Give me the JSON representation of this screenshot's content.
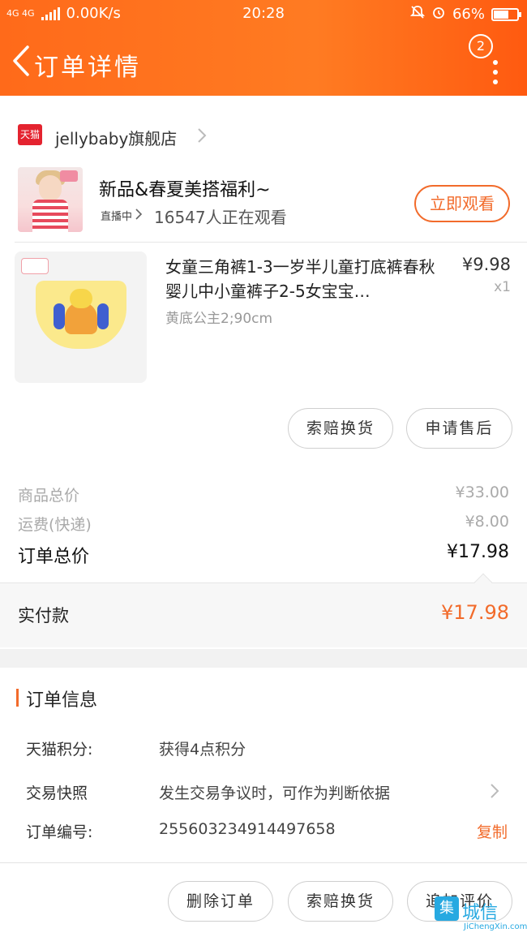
{
  "status_bar": {
    "network": "4G 4G",
    "speed": "0.00K/s",
    "time": "20:28",
    "battery": "66%",
    "battery_level": 0.66
  },
  "header": {
    "title": "订单详情",
    "badge": "2"
  },
  "store": {
    "logo_text": "天猫",
    "name": "jellybaby旗舰店"
  },
  "live": {
    "title": "新品&春夏美搭福利~",
    "status": "直播中",
    "viewers": "16547人正在观看",
    "watch_label": "立即观看"
  },
  "product": {
    "title": "女童三角裤1-3一岁半儿童打底裤春秋婴儿中小童裤子2-5女宝宝…",
    "spec": "黄底公主2;90cm",
    "price": "¥9.98",
    "qty": "x1",
    "exchange_label": "索赔换货",
    "aftersale_label": "申请售后"
  },
  "summary": {
    "goods_label": "商品总价",
    "goods_value": "¥33.00",
    "shipping_label": "运费(快递)",
    "shipping_value": "¥8.00",
    "total_label": "订单总价",
    "total_value": "¥17.98",
    "paid_label": "实付款",
    "paid_value": "¥17.98"
  },
  "order_info": {
    "title": "订单信息",
    "rows": [
      {
        "key": "天猫积分:",
        "value": "获得4点积分"
      },
      {
        "key": "交易快照",
        "value": "发生交易争议时，可作为判断依据"
      },
      {
        "key": "订单编号:",
        "value": "2556032349144976​58",
        "action": "复制"
      }
    ]
  },
  "bottom_actions": {
    "delete_label": "删除订单",
    "exchange_label": "索赔换货",
    "review_label": "追加评价"
  },
  "watermark": {
    "box": "集",
    "text": "城信",
    "url": "JiChengXin.com"
  },
  "colors": {
    "accent": "#f26b2b",
    "header_start": "#ff6a1a",
    "tmall": "#e4232f"
  }
}
